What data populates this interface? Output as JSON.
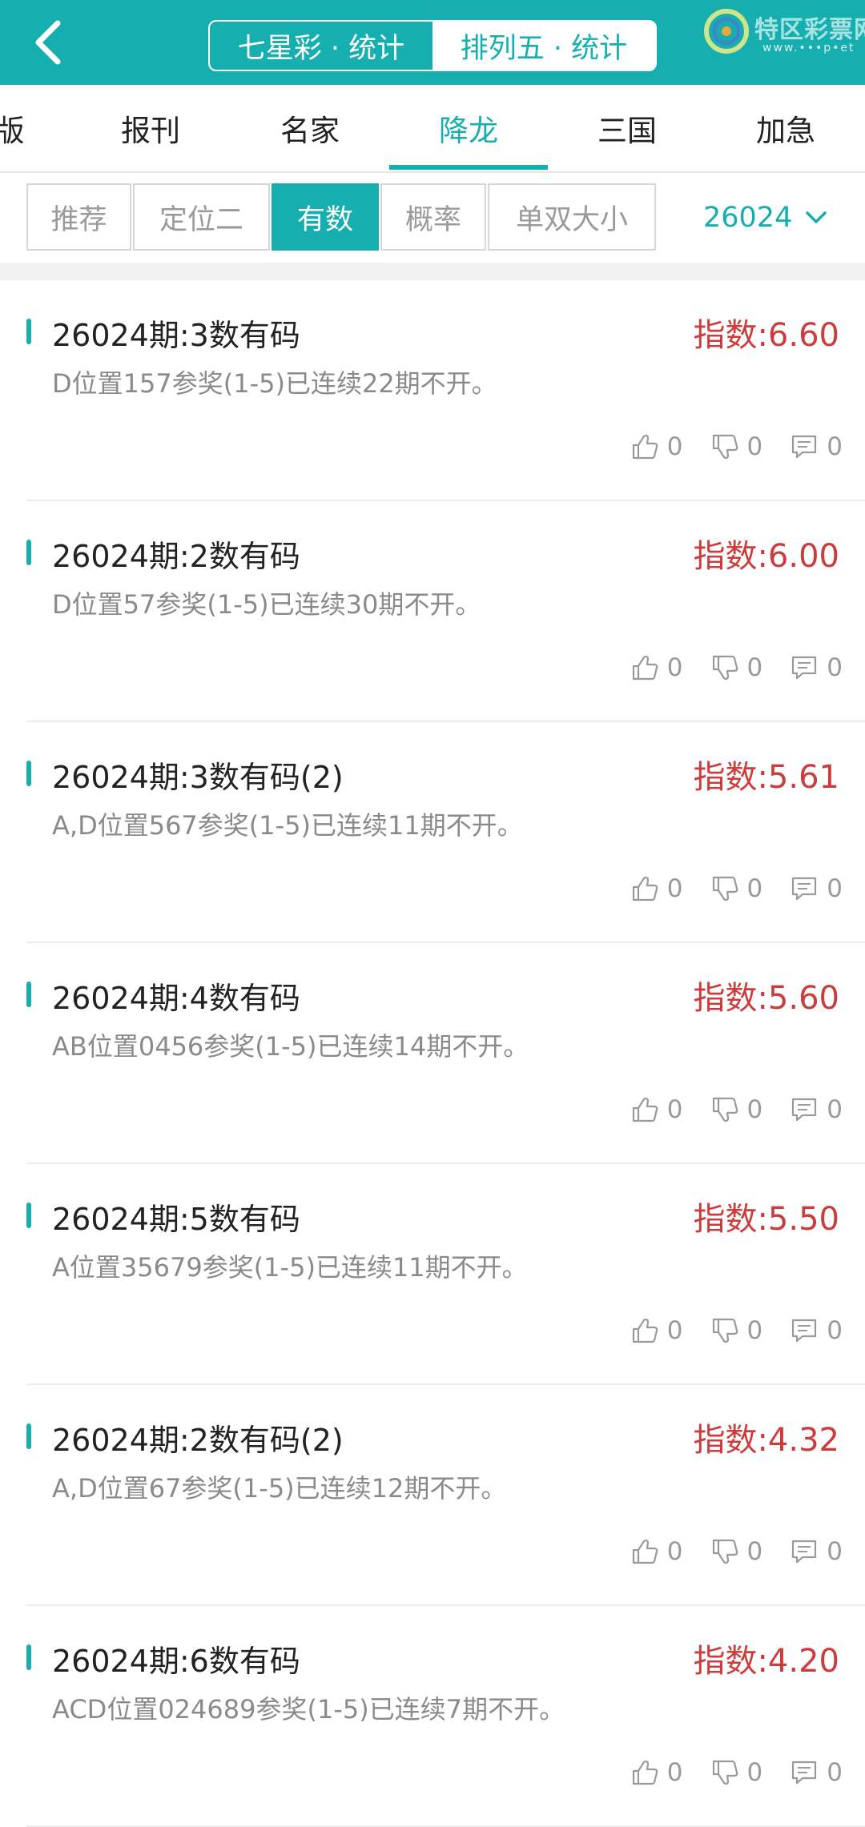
{
  "header": {
    "back_icon": "chevron-left-icon",
    "seg_left": "七星彩 · 统计",
    "seg_right": "排列五 · 统计",
    "logo_text": "特区彩票网",
    "logo_url": "www.•••p•et"
  },
  "nav": {
    "items": [
      "版",
      "报刊",
      "名家",
      "降龙",
      "三国",
      "加急"
    ],
    "active_index": 3
  },
  "filters": {
    "items": [
      "推荐",
      "定位二",
      "有数",
      "概率",
      "单双大小"
    ],
    "active_index": 2,
    "period": "26024",
    "period_icon": "chevron-down-icon"
  },
  "list": [
    {
      "title": "26024期:3数有码",
      "score": "指数:6.60",
      "desc": "D位置157参奖(1-5)已连续22期不开。",
      "likes": "0",
      "dislikes": "0",
      "comments": "0"
    },
    {
      "title": "26024期:2数有码",
      "score": "指数:6.00",
      "desc": "D位置57参奖(1-5)已连续30期不开。",
      "likes": "0",
      "dislikes": "0",
      "comments": "0"
    },
    {
      "title": "26024期:3数有码(2)",
      "score": "指数:5.61",
      "desc": "A,D位置567参奖(1-5)已连续11期不开。",
      "likes": "0",
      "dislikes": "0",
      "comments": "0"
    },
    {
      "title": "26024期:4数有码",
      "score": "指数:5.60",
      "desc": "AB位置0456参奖(1-5)已连续14期不开。",
      "likes": "0",
      "dislikes": "0",
      "comments": "0"
    },
    {
      "title": "26024期:5数有码",
      "score": "指数:5.50",
      "desc": "A位置35679参奖(1-5)已连续11期不开。",
      "likes": "0",
      "dislikes": "0",
      "comments": "0"
    },
    {
      "title": "26024期:2数有码(2)",
      "score": "指数:4.32",
      "desc": "A,D位置67参奖(1-5)已连续12期不开。",
      "likes": "0",
      "dislikes": "0",
      "comments": "0"
    },
    {
      "title": "26024期:6数有码",
      "score": "指数:4.20",
      "desc": "ACD位置024689参奖(1-5)已连续7期不开。",
      "likes": "0",
      "dislikes": "0",
      "comments": "0"
    }
  ],
  "colors": {
    "accent": "#16aeae",
    "score": "#cc3c3c",
    "muted": "#8a8a8a"
  }
}
